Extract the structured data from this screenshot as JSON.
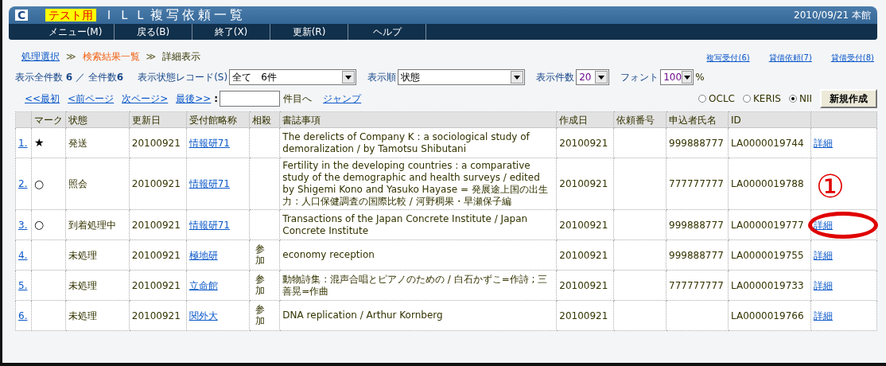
{
  "header": {
    "logo": "C",
    "badge": "テスト用",
    "title": "ＩＬＬ複写依頼一覧",
    "date_location": "2010/09/21 本館"
  },
  "menu": [
    {
      "label": "メニュー(M)"
    },
    {
      "label": "戻る(B)"
    },
    {
      "label": "終了(X)"
    },
    {
      "label": "更新(R)"
    },
    {
      "label": "ヘルプ"
    }
  ],
  "breadcrumb": [
    {
      "label": "処理選択",
      "kind": "link"
    },
    {
      "label": "≫",
      "kind": "separator"
    },
    {
      "label": "検索結果一覧",
      "kind": "current"
    },
    {
      "label": "≫",
      "kind": "separator"
    },
    {
      "label": "詳細表示",
      "kind": "plain"
    }
  ],
  "quick_links": [
    "複写受付(6)",
    "貸借依頼(7)",
    "貸借受付(8)"
  ],
  "count_text": "表示全件数 **6** ／ 全件数**6**",
  "filters": [
    {
      "label": "表示状態レコード(S)",
      "value": "全て　6件",
      "kind": "wide"
    },
    {
      "label": "表示順",
      "value": "状態",
      "kind": "wide"
    },
    {
      "label": "表示件数",
      "value": "20",
      "kind": "narrow"
    },
    {
      "label": "フォント",
      "value": "100",
      "kind": "narrow",
      "suffix": "%"
    }
  ],
  "pager": {
    "links": [
      "<<最初",
      "<前ページ",
      "次ページ>",
      "最後>>"
    ],
    "colon": ":",
    "after_input": "件目へ",
    "jump": "ジャンプ"
  },
  "sources": [
    {
      "label": "OCLC",
      "selected": false
    },
    {
      "label": "KERIS",
      "selected": false
    },
    {
      "label": "NII",
      "selected": true
    }
  ],
  "new_button": "新規作成",
  "columns": [
    "マーク",
    "状態",
    "更新日",
    "受付館略称",
    "相殺",
    "書誌事項",
    "作成日",
    "依頼番号",
    "申込者氏名",
    "ID"
  ],
  "rows": [
    {
      "no": "1.",
      "mark": "★",
      "status": "発送",
      "updated": "20100921",
      "library": "情報研71",
      "offset": "",
      "title": "The derelicts of Company K : a sociological study of demoralization / by Tamotsu Shibutani",
      "created": "20100921",
      "request_no": "",
      "applicant": "999888777",
      "id": "LA0000019744",
      "detail": "詳細",
      "highlighted": false
    },
    {
      "no": "2.",
      "mark": "○",
      "status": "照会",
      "updated": "20100921",
      "library": "情報研71",
      "offset": "",
      "title": "Fertility in the developing countries : a comparative study of the demographic and health surveys / edited by Shigemi Kono and Yasuko Hayase = 発展途上国の出生力 : 人口保健調査の国際比較 / 河野稠果・早瀬保子編",
      "created": "20100921",
      "request_no": "",
      "applicant": "777777777",
      "id": "LA0000019788",
      "highlighted": false
    },
    {
      "no": "3.",
      "mark": "○",
      "status": "到着処理中",
      "updated": "20100921",
      "library": "情報研71",
      "offset": "",
      "title": "Transactions of the Japan Concrete Institute / Japan Concrete Institute",
      "created": "20100921",
      "request_no": "",
      "applicant": "999888777",
      "id": "LA0000019777",
      "detail": "詳細",
      "highlighted": true
    },
    {
      "no": "4.",
      "mark": "",
      "status": "未処理",
      "updated": "20100921",
      "library": "極地研",
      "offset": "参加",
      "title": "economy reception",
      "created": "20100921",
      "request_no": "",
      "applicant": "999888777",
      "id": "LA0000019755",
      "detail": "詳細",
      "highlighted": false
    },
    {
      "no": "5.",
      "mark": "",
      "status": "未処理",
      "updated": "20100921",
      "library": "立命館",
      "offset": "参加",
      "title": "動物詩集 : 混声合唱とピアノのための / 白石かずこ=作詩 ; 三善晃=作曲",
      "created": "20100921",
      "request_no": "",
      "applicant": "777777777",
      "id": "LA0000019733",
      "detail": "詳細",
      "highlighted": false
    },
    {
      "no": "6.",
      "mark": "",
      "status": "未処理",
      "updated": "20100921",
      "library": "関外大",
      "offset": "参加",
      "title": "DNA replication / Arthur Kornberg",
      "created": "20100921",
      "request_no": "",
      "applicant": "",
      "id": "LA0000019766",
      "detail": "詳細",
      "highlighted": false
    }
  ],
  "annotation": {
    "label": "①"
  }
}
